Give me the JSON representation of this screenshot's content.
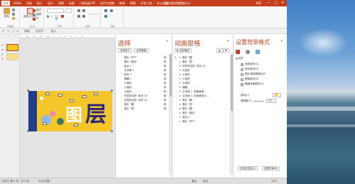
{
  "titlebar": {
    "tabs": [
      "文件",
      "iSlide",
      "开始",
      "插入",
      "设计",
      "切换",
      "动画",
      "口袋动画 PA",
      "幻灯片放映",
      "审阅",
      "视图",
      "开发工具",
      "办公资源"
    ],
    "active_tab_index": 0,
    "title": "告诉我你想要做什么",
    "user": "共享",
    "controls": [
      "—",
      "□",
      "✕"
    ]
  },
  "ribbon": {
    "clipboard": {
      "paste": "粘贴",
      "label": "剪贴板"
    },
    "slides": {
      "new_slide": "新建\n幻灯片",
      "layout": "版式",
      "reset": "重置",
      "section": "节",
      "label": "幻灯片"
    },
    "font": {
      "placeholder": "",
      "label": "字体"
    },
    "paragraph": {
      "label": "段落"
    },
    "draw": {
      "label": "绘图"
    },
    "faint_text": "SmartArt"
  },
  "qat": {
    "items": [
      "↶",
      "↷",
      "▢",
      "▾",
      "表格",
      "幻灯片",
      "插入"
    ]
  },
  "ruler": {
    "ticks": [
      "16",
      "14",
      "12",
      "10",
      "8",
      "6",
      "4",
      "2",
      "0",
      "2",
      "4",
      "6",
      "8",
      "10",
      "12"
    ]
  },
  "thumbnails": {
    "items": [
      {
        "num": "1"
      },
      {
        "num": "2"
      }
    ],
    "star": "★"
  },
  "slide": {
    "text1": "图",
    "text2": "层"
  },
  "selection_pane": {
    "title": "选择",
    "close": "✕",
    "show_all": "全部显示",
    "hide_all": "全部隐藏",
    "items": [
      "图片 \"PPT\"",
      "图片 \"组合\"",
      "组合 2",
      "文本框 1",
      "矩形 1",
      "椭圆 1",
      "小组件",
      "小组件",
      "大矩形",
      "任意多边形: 形状 19",
      "任意多边形: 形状 24",
      "图片 \"图\"",
      "图片 \"层\""
    ],
    "eye": "👁"
  },
  "animation_pane": {
    "title": "动画窗格",
    "close": "✕",
    "play": "▶ 全部播放",
    "up": "▲",
    "down": "▼",
    "items": [
      "图片 \"图\"",
      "图片 \"层\"",
      "任意多边形: 形状 24",
      "大矩形",
      "小矩形",
      "小组件",
      "小组件",
      "椭圆",
      "文本框 1: 电脑就是...",
      "文本框 1: 你就是设计...",
      "图片 \"图\"",
      "图片 \"层\"",
      "图片 \"图\"",
      "图片 \"组合\"",
      "组合 2",
      "图片 \"PPT\""
    ],
    "numbers": [
      "0",
      "",
      "",
      "",
      "",
      "",
      "",
      "",
      "",
      "",
      "",
      "",
      "",
      "",
      "",
      ""
    ]
  },
  "format_pane": {
    "title": "设置背景格式",
    "close": "✕",
    "section": "▲ 填充",
    "options": [
      "纯色填充(S)",
      "渐变填充(G)",
      "图片或纹理填充(P)",
      "图案填充(A)",
      "隐藏背景图形(H)"
    ],
    "selected_option": 0,
    "color_label": "颜色(C)",
    "transparency_label": "透明度(T)",
    "transparency_value": "0%",
    "apply_all": "应用到全部(L)",
    "reset": "重置背景(B)"
  },
  "status": {
    "slide": "幻灯片 第 1 张，共 2 张",
    "lang": "中文(中国)",
    "notes": "备注",
    "comments": "批注",
    "zoom": "22%"
  },
  "colors": {
    "accent": "#c43e1c",
    "slide_bg": "#f4c62a",
    "slide_text": "#2d2777"
  }
}
